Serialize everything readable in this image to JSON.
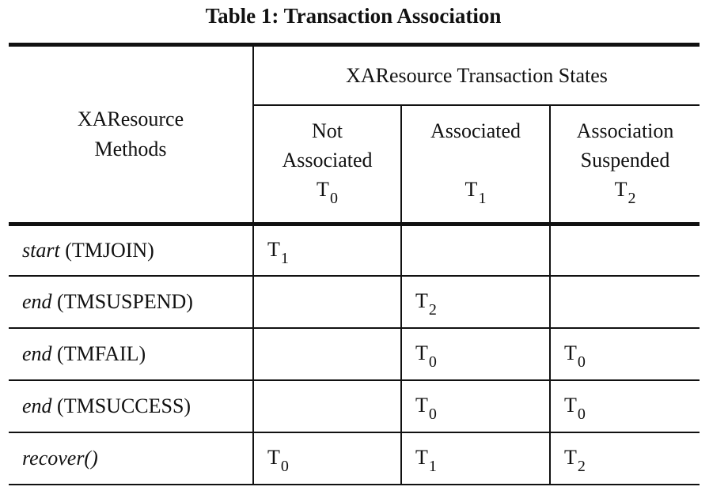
{
  "title": "Table 1: Transaction Association",
  "header": {
    "methods_line1": "XAResource",
    "methods_line2": "Methods",
    "group_label": "XAResource Transaction States",
    "states": [
      {
        "line1": "Not",
        "line2": "Associated",
        "symbol": "T",
        "subscript": "0"
      },
      {
        "line1": "Associated",
        "line2": "",
        "symbol": "T",
        "subscript": "1"
      },
      {
        "line1": "Association",
        "line2": "Suspended",
        "symbol": "T",
        "subscript": "2"
      }
    ]
  },
  "rows": [
    {
      "method_name": "start",
      "method_arg": "(TMJOIN)",
      "cells": [
        {
          "symbol": "T",
          "subscript": "1"
        },
        {
          "symbol": "",
          "subscript": ""
        },
        {
          "symbol": "",
          "subscript": ""
        }
      ]
    },
    {
      "method_name": "end",
      "method_arg": "(TMSUSPEND)",
      "cells": [
        {
          "symbol": "",
          "subscript": ""
        },
        {
          "symbol": "T",
          "subscript": "2"
        },
        {
          "symbol": "",
          "subscript": ""
        }
      ]
    },
    {
      "method_name": "end",
      "method_arg": "(TMFAIL)",
      "cells": [
        {
          "symbol": "",
          "subscript": ""
        },
        {
          "symbol": "T",
          "subscript": "0"
        },
        {
          "symbol": "T",
          "subscript": "0"
        }
      ]
    },
    {
      "method_name": "end",
      "method_arg": "(TMSUCCESS)",
      "cells": [
        {
          "symbol": "",
          "subscript": ""
        },
        {
          "symbol": "T",
          "subscript": "0"
        },
        {
          "symbol": "T",
          "subscript": "0"
        }
      ]
    },
    {
      "method_name": "recover()",
      "method_arg": "",
      "cells": [
        {
          "symbol": "T",
          "subscript": "0"
        },
        {
          "symbol": "T",
          "subscript": "1"
        },
        {
          "symbol": "T",
          "subscript": "2"
        }
      ]
    }
  ]
}
